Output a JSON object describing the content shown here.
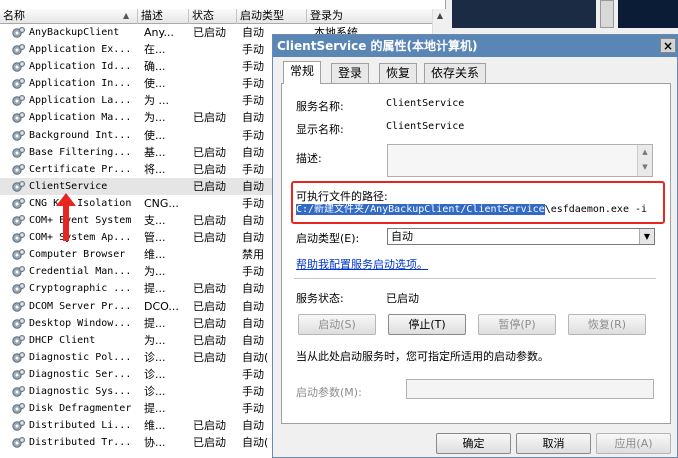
{
  "columns": {
    "name": "名称",
    "description": "描述",
    "status": "状态",
    "startup_type": "启动类型",
    "logon_as": "登录为"
  },
  "services": [
    {
      "name": "AnyBackupClient",
      "desc": "Any...",
      "status": "已启动",
      "startup": "自动",
      "logon": "本地系统"
    },
    {
      "name": "Application Ex...",
      "desc": "在...",
      "status": "",
      "startup": "手动",
      "logon": ""
    },
    {
      "name": "Application Id...",
      "desc": "确...",
      "status": "",
      "startup": "手动",
      "logon": ""
    },
    {
      "name": "Application In...",
      "desc": "使...",
      "status": "",
      "startup": "手动",
      "logon": ""
    },
    {
      "name": "Application La...",
      "desc": "为 ...",
      "status": "",
      "startup": "手动",
      "logon": ""
    },
    {
      "name": "Application Ma...",
      "desc": "为...",
      "status": "已启动",
      "startup": "自动",
      "logon": ""
    },
    {
      "name": "Background Int...",
      "desc": "使...",
      "status": "",
      "startup": "手动",
      "logon": ""
    },
    {
      "name": "Base Filtering...",
      "desc": "基...",
      "status": "已启动",
      "startup": "自动",
      "logon": ""
    },
    {
      "name": "Certificate Pr...",
      "desc": "将...",
      "status": "已启动",
      "startup": "手动",
      "logon": ""
    },
    {
      "name": "ClientService",
      "desc": "",
      "status": "已启动",
      "startup": "自动",
      "logon": ""
    },
    {
      "name": "CNG Key Isolation",
      "desc": "CNG...",
      "status": "",
      "startup": "手动",
      "logon": ""
    },
    {
      "name": "COM+ Event System",
      "desc": "支...",
      "status": "已启动",
      "startup": "自动",
      "logon": ""
    },
    {
      "name": "COM+ System Ap...",
      "desc": "管...",
      "status": "已启动",
      "startup": "自动",
      "logon": ""
    },
    {
      "name": "Computer Browser",
      "desc": "维...",
      "status": "",
      "startup": "禁用",
      "logon": ""
    },
    {
      "name": "Credential Man...",
      "desc": "为...",
      "status": "",
      "startup": "手动",
      "logon": ""
    },
    {
      "name": "Cryptographic ...",
      "desc": "提...",
      "status": "已启动",
      "startup": "自动",
      "logon": ""
    },
    {
      "name": "DCOM Server Pr...",
      "desc": "DCO...",
      "status": "已启动",
      "startup": "自动",
      "logon": ""
    },
    {
      "name": "Desktop Window...",
      "desc": "提...",
      "status": "已启动",
      "startup": "自动",
      "logon": ""
    },
    {
      "name": "DHCP Client",
      "desc": "为...",
      "status": "已启动",
      "startup": "自动",
      "logon": ""
    },
    {
      "name": "Diagnostic Pol...",
      "desc": "诊...",
      "status": "已启动",
      "startup": "自动(",
      "logon": ""
    },
    {
      "name": "Diagnostic Ser...",
      "desc": "诊...",
      "status": "",
      "startup": "手动",
      "logon": ""
    },
    {
      "name": "Diagnostic Sys...",
      "desc": "诊...",
      "status": "",
      "startup": "手动",
      "logon": ""
    },
    {
      "name": "Disk Defragmenter",
      "desc": "提...",
      "status": "",
      "startup": "手动",
      "logon": ""
    },
    {
      "name": "Distributed Li...",
      "desc": "维...",
      "status": "已启动",
      "startup": "自动",
      "logon": ""
    },
    {
      "name": "Distributed Tr...",
      "desc": "协...",
      "status": "已启动",
      "startup": "自动(",
      "logon": ""
    }
  ],
  "dialog": {
    "title": "ClientService 的属性(本地计算机)",
    "close": "×",
    "tabs": [
      "常规",
      "登录",
      "恢复",
      "依存关系"
    ],
    "service_name_label": "服务名称:",
    "service_name_value": "ClientService",
    "display_name_label": "显示名称:",
    "display_name_value": "ClientService",
    "description_label": "描述:",
    "path_label": "可执行文件的路径:",
    "path_selected": "C:/新建文件夹/AnyBackupClient/ClientService",
    "path_rest": "\\esfdaemon.exe -i",
    "startup_type_label": "启动类型(E):",
    "startup_type_value": "自动",
    "help_link": "帮助我配置服务启动选项。",
    "status_label": "服务状态:",
    "status_value": "已启动",
    "btn_start": "启动(S)",
    "btn_stop": "停止(T)",
    "btn_pause": "暂停(P)",
    "btn_resume": "恢复(R)",
    "hint": "当从此处启动服务时，您可指定所适用的启动参数。",
    "params_label": "启动参数(M):",
    "ok": "确定",
    "cancel": "取消",
    "apply": "应用(A)"
  },
  "colors": {
    "highlight_box": "#e8261f",
    "selection": "#3169c6",
    "titlebar": "#5a86b5",
    "link": "#0033cc"
  }
}
